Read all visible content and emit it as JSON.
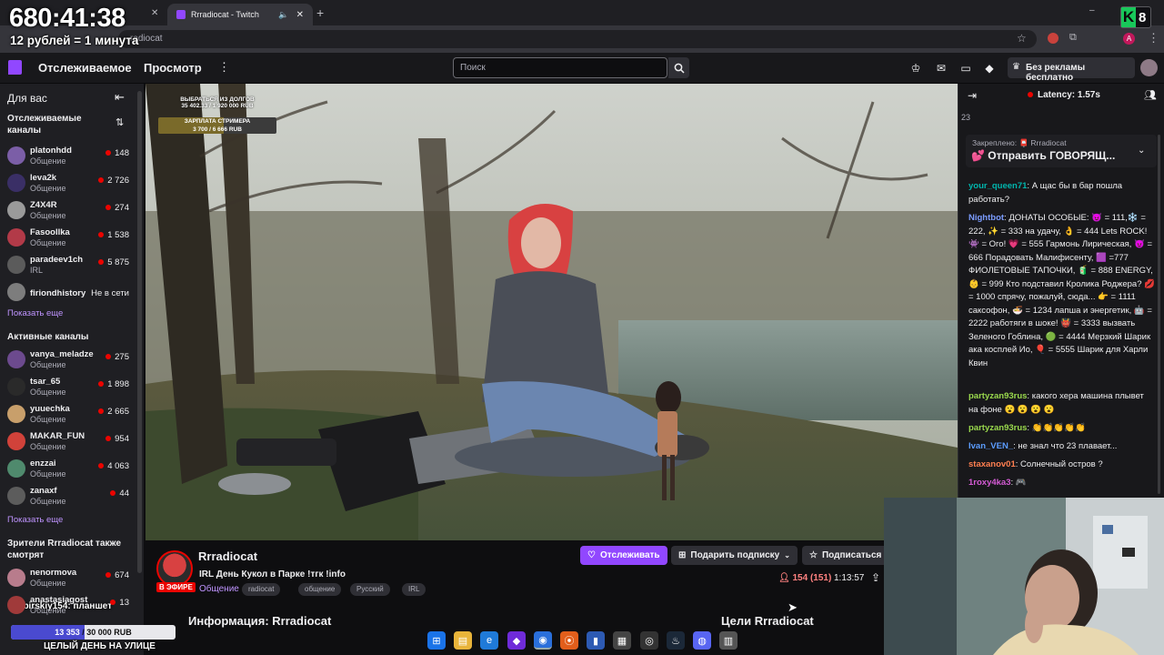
{
  "overlay": {
    "timer": "680:41:38",
    "timer_sub": "12 рублей = 1 минута",
    "k_badge_letter": "K",
    "k_badge_number": "8",
    "goal_current": "13 353",
    "goal_total": "/ 30 000 RUB",
    "goal_fraction": 0.445,
    "goal_text": "ЦЕЛЫЙ ДЕНЬ НА УЛИЦЕ",
    "donation_text": "Sibirskiy154: планшет"
  },
  "browser": {
    "tab_title": "Rrradiocat - Twitch",
    "address": "radiocat"
  },
  "nav": {
    "following": "Отслеживаемое",
    "browse": "Просмотр",
    "search_placeholder": "Поиск",
    "noads": "Без рекламы бесплатно"
  },
  "sidebar": {
    "title": "Для вас",
    "followed_header_1": "Отслеживаемые",
    "followed_header_2": "каналы",
    "followed": [
      {
        "name": "platonhdd",
        "category": "Общение",
        "viewers": "148",
        "color": "#7b5ea7"
      },
      {
        "name": "leva2k",
        "category": "Общение",
        "viewers": "2 726",
        "color": "#3a2f66"
      },
      {
        "name": "Z4X4R",
        "category": "Общение",
        "viewers": "274",
        "color": "#9a9a9a"
      },
      {
        "name": "Fasoollka",
        "category": "Общение",
        "viewers": "1 538",
        "color": "#b23a48"
      },
      {
        "name": "paradeev1ch",
        "category": "IRL",
        "viewers": "5 875",
        "color": "#5b5b5b"
      },
      {
        "name": "firiondhistory",
        "category": "",
        "viewers": "Не в сети",
        "color": "#7d7d7d"
      }
    ],
    "show_more": "Показать еще",
    "active_header": "Активные каналы",
    "active": [
      {
        "name": "vanya_meladze",
        "category": "Общение",
        "viewers": "275",
        "color": "#6c4a8e"
      },
      {
        "name": "tsar_65",
        "category": "Общение",
        "viewers": "1 898",
        "color": "#2a2a2a"
      },
      {
        "name": "yuuechka",
        "category": "Общение",
        "viewers": "2 665",
        "color": "#c89f6b"
      },
      {
        "name": "MAKAR_FUN",
        "category": "Общение",
        "viewers": "954",
        "color": "#d1423a"
      },
      {
        "name": "enzzai",
        "category": "Общение",
        "viewers": "4 063",
        "color": "#4f8a6d"
      },
      {
        "name": "zanaxf",
        "category": "Общение",
        "viewers": "44",
        "color": "#5c5c5c"
      }
    ],
    "show_more_2": "Показать еще",
    "also_header_1": "Зрители Rrradiocat также",
    "also_header_2": "смотрят",
    "also": [
      {
        "name": "nenormova",
        "category": "Общение",
        "viewers": "674",
        "color": "#b87c8c"
      },
      {
        "name": "anastasiagost",
        "category": "Общение",
        "viewers": "13",
        "color": "#a03a3a"
      }
    ]
  },
  "stream_overlay": {
    "line1": "ВЫБРАТЬСЯ ИЗ ДОЛГОВ",
    "line2": "35 402.33 / 1 920 000 RUB",
    "line3": "ЗАРПЛАТА СТРИМЕРА",
    "line4": "3 700 / 6 666 RUB",
    "salary_fraction": 0.555
  },
  "stream": {
    "channel": "Rrradiocat",
    "title": "IRL День Кукол в Парке !тгк !info",
    "live_badge": "В ЭФИРЕ",
    "category": "Общение",
    "tags": [
      "radiocat",
      "общение",
      "Русский",
      "IRL"
    ],
    "follow": "Отслеживать",
    "gift": "Подарить подписку",
    "subscribe": "Подписаться",
    "viewers": "154 (151)",
    "uptime": "1:13:57",
    "about": "Информация: Rrradiocat",
    "goals": "Цели Rrradiocat"
  },
  "chat": {
    "latency": "Latency: 1.57s",
    "count": "23",
    "pinned_label": "Закреплено: 📮 Rrradiocat",
    "pinned_text": "💕 Отправить ГОВОРЯЩ...",
    "messages": [
      {
        "user": "your_queen71",
        "color": "#00b5ad",
        "text": "А щас бы в бар пошла работать?"
      },
      {
        "user": "Nightbot",
        "color": "#7b9cff",
        "text": "ДОНАТЫ ОСОБЫЕ: 😈 = 111,❄️ = 222, ✨ = 333 на удачу, 👌 = 444 Lets ROCK! 👾 = Ого! 💗 = 555 Гармонь Лирическая, 😈 = 666 Порадовать Малифисенту, 🟪 =777 ФИОЛЕТОВЫЕ ТАПОЧКИ, 🧃 = 888 ENERGY, 👶 = 999 Кто подставил Кролика Роджера? 💋 = 1000 спрячу, пожалуй, сюда... 👉 = 1111 саксофон, 🍜 = 1234 лапша и энергетик, 🤖 = 2222 работяги в шоке! 👹 = 3333 вызвать Зеленого Гоблина, 🟢 = 4444 Мерзкий Шарик ака косплей Ио, 🎈 = 5555 Шарик для Харли Квин"
      },
      {
        "user": "partyzan93rus",
        "color": "#9ad94d",
        "text": "какого хера машина плывет на фоне 😮 😮 😮 😮"
      },
      {
        "user": "partyzan93rus",
        "color": "#9ad94d",
        "text": "👏👏👏👏👏"
      },
      {
        "user": "Ivan_VEN_",
        "color": "#5c9dff",
        "text": "не знал что 23 плавает..."
      },
      {
        "user": "staxanov01",
        "color": "#ff7f50",
        "text": "Солнечный остров ?"
      },
      {
        "user": "1roxy4ka3",
        "color": "#d55bd5",
        "text": "🎮"
      }
    ]
  }
}
